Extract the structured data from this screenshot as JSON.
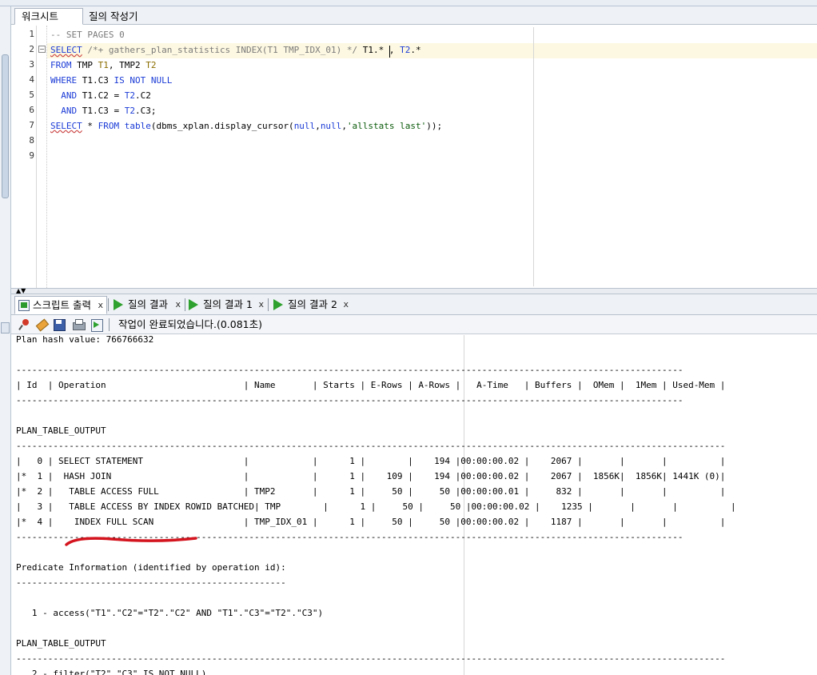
{
  "editor_tabs": [
    "워크시트",
    "질의 작성기"
  ],
  "editor": {
    "line_numbers": [
      "1",
      "2",
      "3",
      "4",
      "5",
      "6",
      "7",
      "8",
      "9"
    ]
  },
  "output_tabs": [
    {
      "label": "스크립트 출력",
      "close": "x"
    },
    {
      "label": "질의 결과",
      "close": "x"
    },
    {
      "label": "질의 결과 1",
      "close": "x"
    },
    {
      "label": "질의 결과 2",
      "close": "x"
    }
  ],
  "toolbar": {
    "status": "작업이 완료되었습니다.(0.081초)"
  },
  "output_lines": [
    "Plan hash value: 766766632",
    "",
    "------------------------------------------------------------------------------------------------------------------------------",
    "| Id  | Operation                          | Name       | Starts | E-Rows | A-Rows |   A-Time   | Buffers |  OMem |  1Mem | Used-Mem |",
    "------------------------------------------------------------------------------------------------------------------------------",
    "",
    "PLAN_TABLE_OUTPUT",
    "--------------------------------------------------------------------------------------------------------------------------------------",
    "|   0 | SELECT STATEMENT                   |            |      1 |        |    194 |00:00:00.02 |    2067 |       |       |          |",
    "|*  1 |  HASH JOIN                         |            |      1 |    109 |    194 |00:00:00.02 |    2067 |  1856K|  1856K| 1441K (0)|",
    "|*  2 |   TABLE ACCESS FULL                | TMP2       |      1 |     50 |     50 |00:00:00.01 |     832 |       |       |          |",
    "|   3 |   TABLE ACCESS BY INDEX ROWID BATCHED| TMP        |      1 |     50 |     50 |00:00:00.02 |    1235 |       |       |          |",
    "|*  4 |    INDEX FULL SCAN                 | TMP_IDX_01 |      1 |     50 |     50 |00:00:00.02 |    1187 |       |       |          |",
    "------------------------------------------------------------------------------------------------------------------------------",
    "",
    "Predicate Information (identified by operation id):",
    "---------------------------------------------------",
    "",
    "   1 - access(\"T1\".\"C2\"=\"T2\".\"C2\" AND \"T1\".\"C3\"=\"T2\".\"C3\")",
    "",
    "PLAN_TABLE_OUTPUT",
    "--------------------------------------------------------------------------------------------------------------------------------------",
    "   2 - filter(\"T2\".\"C3\" IS NOT NULL)"
  ],
  "colors": {
    "keyword": "#1b3bd6",
    "comment": "#7a7a7a",
    "string": "#0a5a0a",
    "annotation_stroke": "#d4141e"
  }
}
